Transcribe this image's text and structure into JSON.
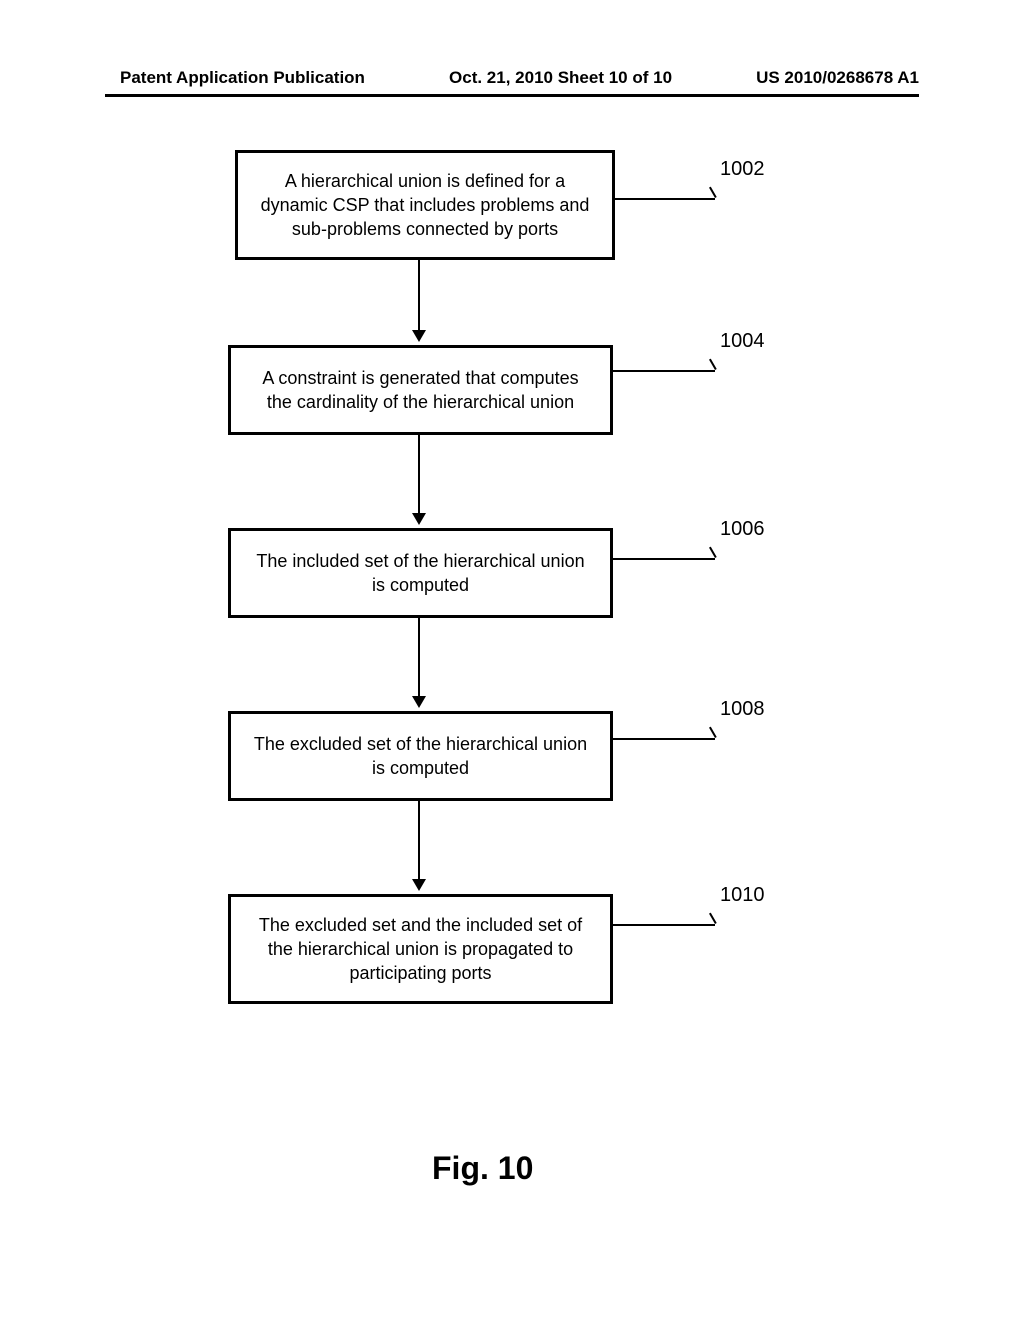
{
  "header": {
    "left": "Patent Application Publication",
    "center": "Oct. 21, 2010  Sheet 10 of 10",
    "right": "US 2010/0268678 A1"
  },
  "boxes": {
    "b1": "A hierarchical union is defined for a dynamic CSP that includes problems and sub-problems connected by ports",
    "b2": "A constraint is generated that computes the cardinality of the hierarchical union",
    "b3": "The included set of the hierarchical union is computed",
    "b4": "The excluded set of the hierarchical union is computed",
    "b5": "The excluded set and the included set of the hierarchical union is propagated to participating ports"
  },
  "labels": {
    "l1": "1002",
    "l2": "1004",
    "l3": "1006",
    "l4": "1008",
    "l5": "1010"
  },
  "caption": "Fig. 10"
}
